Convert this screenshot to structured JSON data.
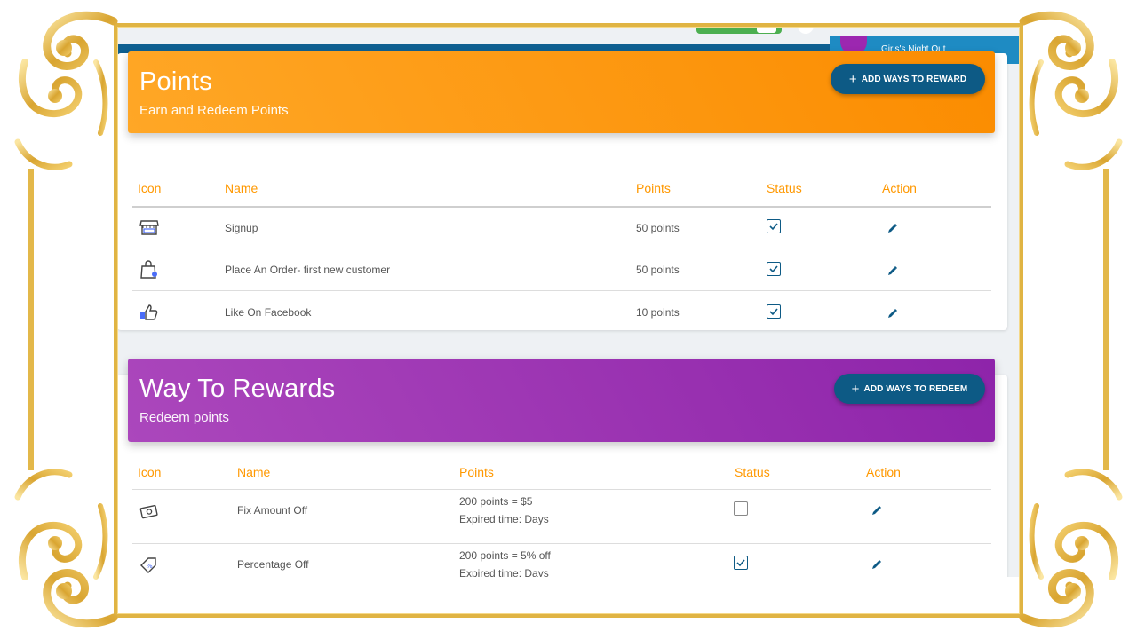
{
  "topbar": {
    "store_name": "Girls's Night Out"
  },
  "points_section": {
    "title": "Points",
    "subtitle": "Earn and Redeem Points",
    "add_button_label": "ADD WAYS TO REWARD",
    "columns": [
      "Icon",
      "Name",
      "Points",
      "Status",
      "Action"
    ],
    "rows": [
      {
        "icon": "storefront-icon",
        "name": "Signup",
        "points": "50 points",
        "status": true
      },
      {
        "icon": "shopping-bag-icon",
        "name": "Place An Order- first new customer",
        "points": "50 points",
        "status": true
      },
      {
        "icon": "thumbs-up-icon",
        "name": "Like On Facebook",
        "points": "10 points",
        "status": true
      }
    ]
  },
  "rewards_section": {
    "title": "Way To Rewards",
    "subtitle": "Redeem points",
    "add_button_label": "ADD WAYS TO REDEEM",
    "columns": [
      "Icon",
      "Name",
      "Points",
      "Status",
      "Action"
    ],
    "rows": [
      {
        "icon": "cash-icon",
        "name": "Fix Amount Off",
        "points": "200 points = $5",
        "detail": "Expired time: Days",
        "status": false
      },
      {
        "icon": "discount-tag-icon",
        "name": "Percentage Off",
        "points": "200 points = 5% off",
        "detail": "Expired time: Days",
        "status": true
      }
    ]
  },
  "colors": {
    "orange": "#fb8c00",
    "purple": "#8e24aa",
    "navy": "#0d5a85",
    "gold": "#e0b443"
  }
}
